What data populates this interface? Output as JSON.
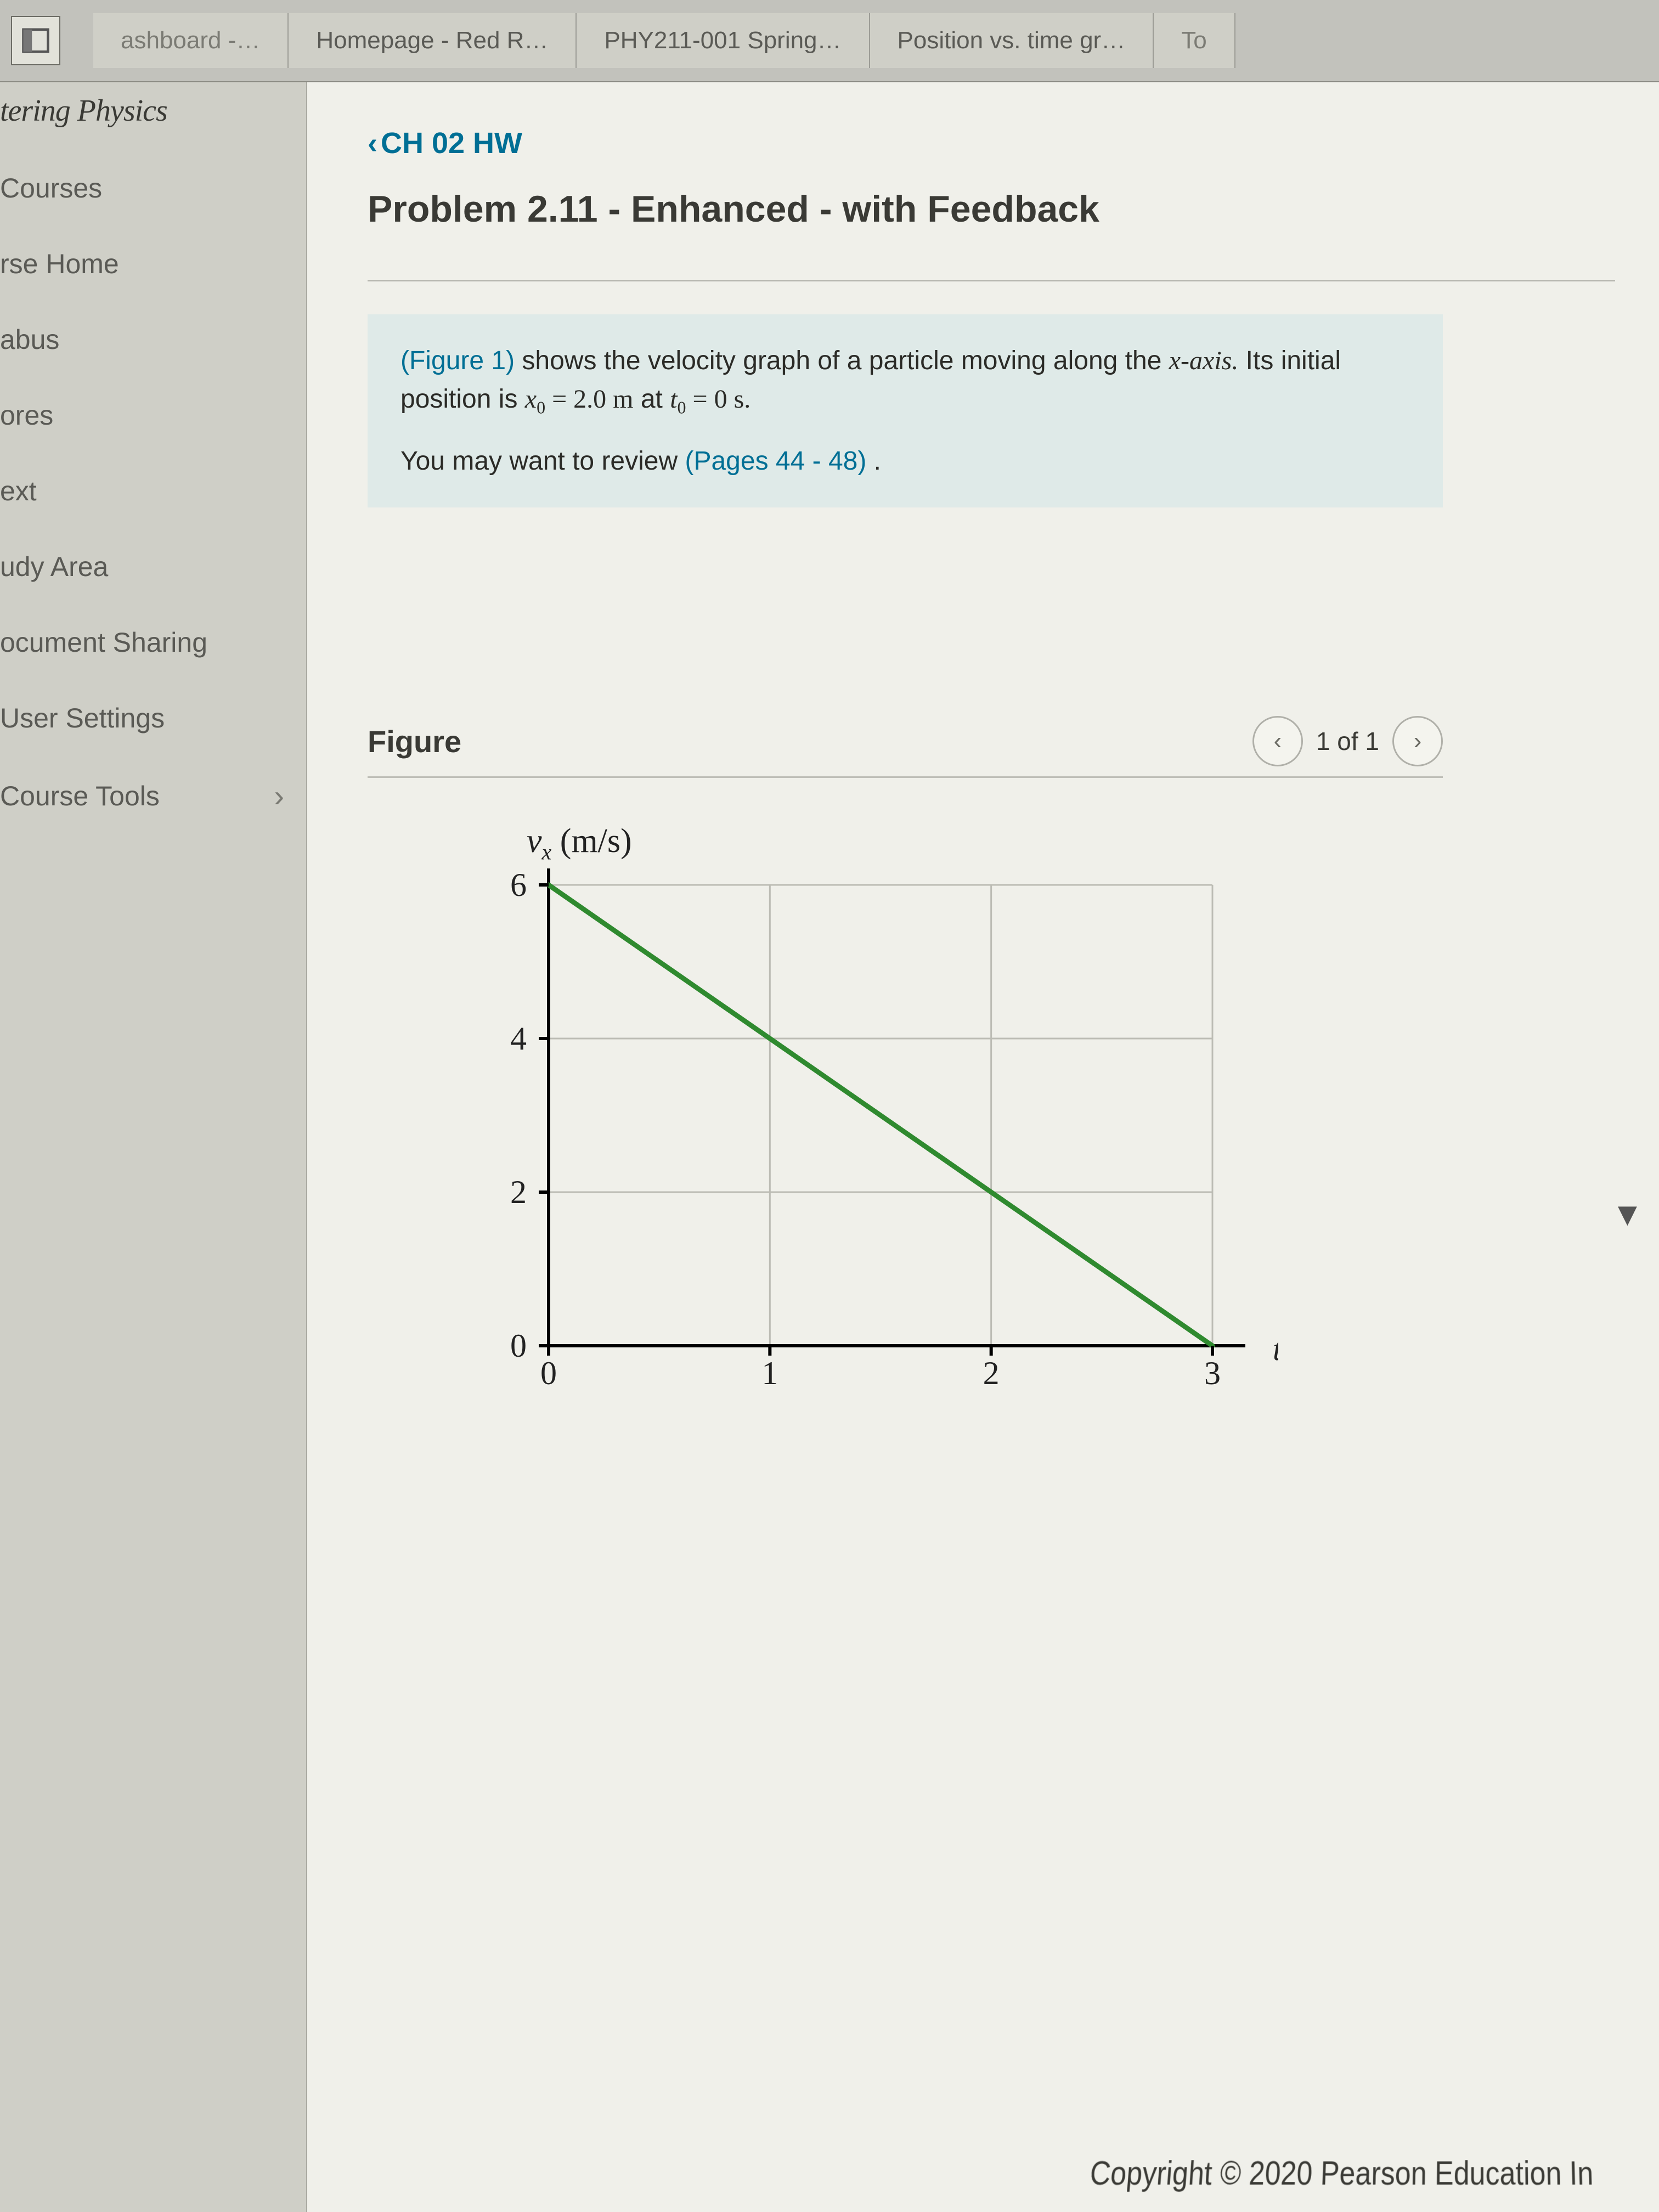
{
  "tabs": {
    "t0": "ashboard -…",
    "t1": "Homepage - Red R…",
    "t2": "PHY211-001 Spring…",
    "t3": "Position vs. time gr…",
    "t4": "To"
  },
  "brand": "tering Physics",
  "nav": {
    "courses": "Courses",
    "home": "rse Home",
    "syllabus": "abus",
    "scores": "ores",
    "etext": "ext",
    "study": "udy Area",
    "doc": "ocument Sharing",
    "user": "User Settings",
    "tools": "Course Tools"
  },
  "back": "CH 02 HW",
  "title": "Problem 2.11 - Enhanced - with Feedback",
  "prompt": {
    "figref": "(Figure 1)",
    "line1a": " shows the velocity graph of a particle moving along the ",
    "xaxis": "x-axis.",
    "line1b": " Its initial position is ",
    "x0": "x",
    "x0sub": "0",
    "eq1": " = 2.0 m",
    "line1c": " at ",
    "t0": "t",
    "t0sub": "0",
    "eq2": " = 0 s.",
    "review_a": "You may want to review ",
    "review_b": "(Pages 44 - 48)",
    "review_c": " ."
  },
  "figure": {
    "label": "Figure",
    "pager": "1 of 1"
  },
  "chart_data": {
    "type": "line",
    "title": "",
    "xlabel": "t (s)",
    "ylabel": "v_x (m/s)",
    "xlim": [
      0,
      3
    ],
    "ylim": [
      0,
      6
    ],
    "xticks": [
      0,
      1,
      2,
      3
    ],
    "yticks": [
      0,
      2,
      4,
      6
    ],
    "series": [
      {
        "name": "v_x",
        "x": [
          0,
          3
        ],
        "y": [
          6,
          0
        ],
        "color": "#2f8a2f"
      }
    ]
  },
  "copyright": "Copyright © 2020 Pearson Education In"
}
